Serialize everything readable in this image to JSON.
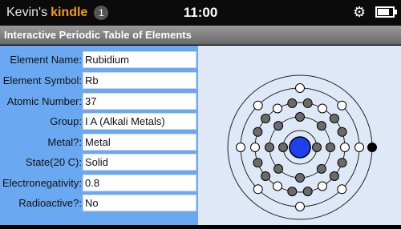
{
  "statusbar": {
    "owner": "Kevin's",
    "app": "kindle",
    "notifications": "1",
    "time": "11:00",
    "icons": [
      "gear-icon",
      "battery-icon"
    ]
  },
  "title": "Interactive Periodic Table of Elements",
  "fields": [
    {
      "label": "Element Name:",
      "value": "Rubidium"
    },
    {
      "label": "Element Symbol:",
      "value": "Rb"
    },
    {
      "label": "Atomic Number:",
      "value": "37"
    },
    {
      "label": "Group:",
      "value": "I A (Alkali Metals)"
    },
    {
      "label": "Metal?:",
      "value": "Metal"
    },
    {
      "label": "State(20 C):",
      "value": "Solid"
    },
    {
      "label": "Electronegativity:",
      "value": "0.8"
    },
    {
      "label": "Radioactive?:",
      "value": "No"
    }
  ],
  "atom": {
    "electron_shells": [
      2,
      8,
      18,
      8,
      1
    ],
    "colors": {
      "nucleus": "#1f3ff0",
      "paired_electron": "#6b6b6b",
      "unpaired_electron": "#ffffff",
      "valence_electron": "#000000",
      "orbit": "#222222"
    }
  }
}
